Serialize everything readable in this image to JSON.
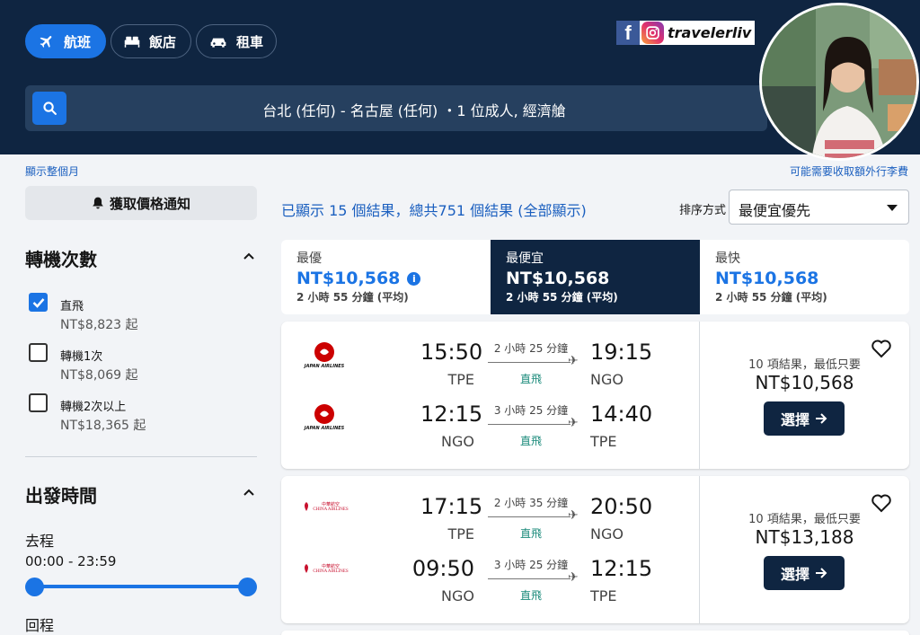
{
  "nav": {
    "flights": "航班",
    "hotels": "飯店",
    "cars": "租車"
  },
  "brand": {
    "fb": "f",
    "name": "travelerliv"
  },
  "search": {
    "summary": "台北 (任何) - 名古屋 (任何) ・1 位成人, 經濟艙"
  },
  "links": {
    "show_month": "顯示整個月",
    "baggage_fee": "可能需要收取額外行李費"
  },
  "sidebar": {
    "price_alert": "獲取價格通知",
    "stops_title": "轉機次數",
    "stops": [
      {
        "label": "直飛",
        "price": "NT$8,823 起",
        "checked": true
      },
      {
        "label": "轉機1次",
        "price": "NT$8,069 起",
        "checked": false
      },
      {
        "label": "轉機2次以上",
        "price": "NT$18,365 起",
        "checked": false
      }
    ],
    "departure_title": "出發時間",
    "outbound_label": "去程",
    "outbound_range": "00:00 - 23:59",
    "return_label": "回程"
  },
  "results": {
    "count_text": "已顯示 15 個結果，總共751 個結果 (全部顯示)",
    "sort_label": "排序方式",
    "sort_value": "最便宜優先"
  },
  "sort_tabs": [
    {
      "title": "最優",
      "price": "NT$10,568",
      "duration": "2 小時 55 分鐘 (平均)",
      "info": "i"
    },
    {
      "title": "最便宜",
      "price": "NT$10,568",
      "duration": "2 小時 55 分鐘 (平均)"
    },
    {
      "title": "最快",
      "price": "NT$10,568",
      "duration": "2 小時 55 分鐘 (平均)"
    }
  ],
  "cards": [
    {
      "airline": "JAPAN AIRLINES",
      "logo_color": "#cc0000",
      "legs": [
        {
          "dep_time": "15:50",
          "dep_airport": "TPE",
          "arr_time": "19:15",
          "arr_airport": "NGO",
          "duration": "2 小時 25 分鐘",
          "stops": "直飛"
        },
        {
          "dep_time": "12:15",
          "dep_airport": "NGO",
          "arr_time": "14:40",
          "arr_airport": "TPE",
          "duration": "3 小時 25 分鐘",
          "stops": "直飛"
        }
      ],
      "deal_text": "10 項結果，最低只要",
      "price": "NT$10,568",
      "select_label": "選擇"
    },
    {
      "airline": "CHINA AIRLINES",
      "airline_local": "中華航空",
      "logo_color": "#c8102e",
      "legs": [
        {
          "dep_time": "17:15",
          "dep_airport": "TPE",
          "arr_time": "20:50",
          "arr_airport": "NGO",
          "duration": "2 小時 35 分鐘",
          "stops": "直飛"
        },
        {
          "dep_time": "09:50",
          "dep_airport": "NGO",
          "arr_time": "12:15",
          "arr_airport": "TPE",
          "duration": "3 小時 25 分鐘",
          "stops": "直飛"
        }
      ],
      "deal_text": "10 項結果，最低只要",
      "price": "NT$13,188",
      "select_label": "選擇"
    }
  ],
  "colors": {
    "header_bg": "#0f2541",
    "accent": "#1b74e4",
    "direct": "#1a8a7a"
  }
}
